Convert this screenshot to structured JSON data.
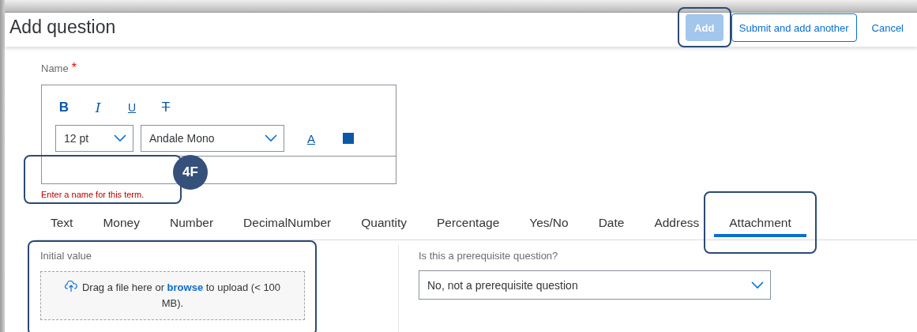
{
  "header": {
    "title": "Add question",
    "buttons": [
      {
        "label": "Add",
        "kind": "primary",
        "disabled": true,
        "highlighted": true
      },
      {
        "label": "Submit and add another",
        "kind": "outline",
        "disabled": false,
        "highlighted": false
      },
      {
        "label": "Cancel",
        "kind": "link",
        "disabled": false,
        "highlighted": false
      }
    ]
  },
  "name_field": {
    "label": "Name",
    "required_mark": "*",
    "format_buttons": [
      {
        "kind": "bold",
        "label": "B"
      },
      {
        "kind": "italic",
        "label": "I"
      },
      {
        "kind": "underline",
        "label": "U"
      },
      {
        "kind": "strike",
        "label": "T"
      }
    ],
    "font_size": "12 pt",
    "font_family": "Andale Mono",
    "text_color_label": "A",
    "error": "Enter a name for this term.",
    "highlighted": true,
    "callout": "4F"
  },
  "tabs": [
    {
      "label": "Text",
      "selected": false,
      "highlighted": false
    },
    {
      "label": "Money",
      "selected": false,
      "highlighted": false
    },
    {
      "label": "Number",
      "selected": false,
      "highlighted": false
    },
    {
      "label": "DecimalNumber",
      "selected": false,
      "highlighted": false
    },
    {
      "label": "Quantity",
      "selected": false,
      "highlighted": false
    },
    {
      "label": "Percentage",
      "selected": false,
      "highlighted": false
    },
    {
      "label": "Yes/No",
      "selected": false,
      "highlighted": false
    },
    {
      "label": "Date",
      "selected": false,
      "highlighted": false
    },
    {
      "label": "Address",
      "selected": false,
      "highlighted": false
    },
    {
      "label": "Attachment",
      "selected": true,
      "highlighted": true
    }
  ],
  "initial_value": {
    "label": "Initial value",
    "text_before": "Drag a file here or",
    "link": "browse",
    "text_after": "to upload (< 100 MB).",
    "highlighted": true
  },
  "prerequisite": {
    "label": "Is this a prerequisite question?",
    "value": "No, not a prerequisite question"
  }
}
